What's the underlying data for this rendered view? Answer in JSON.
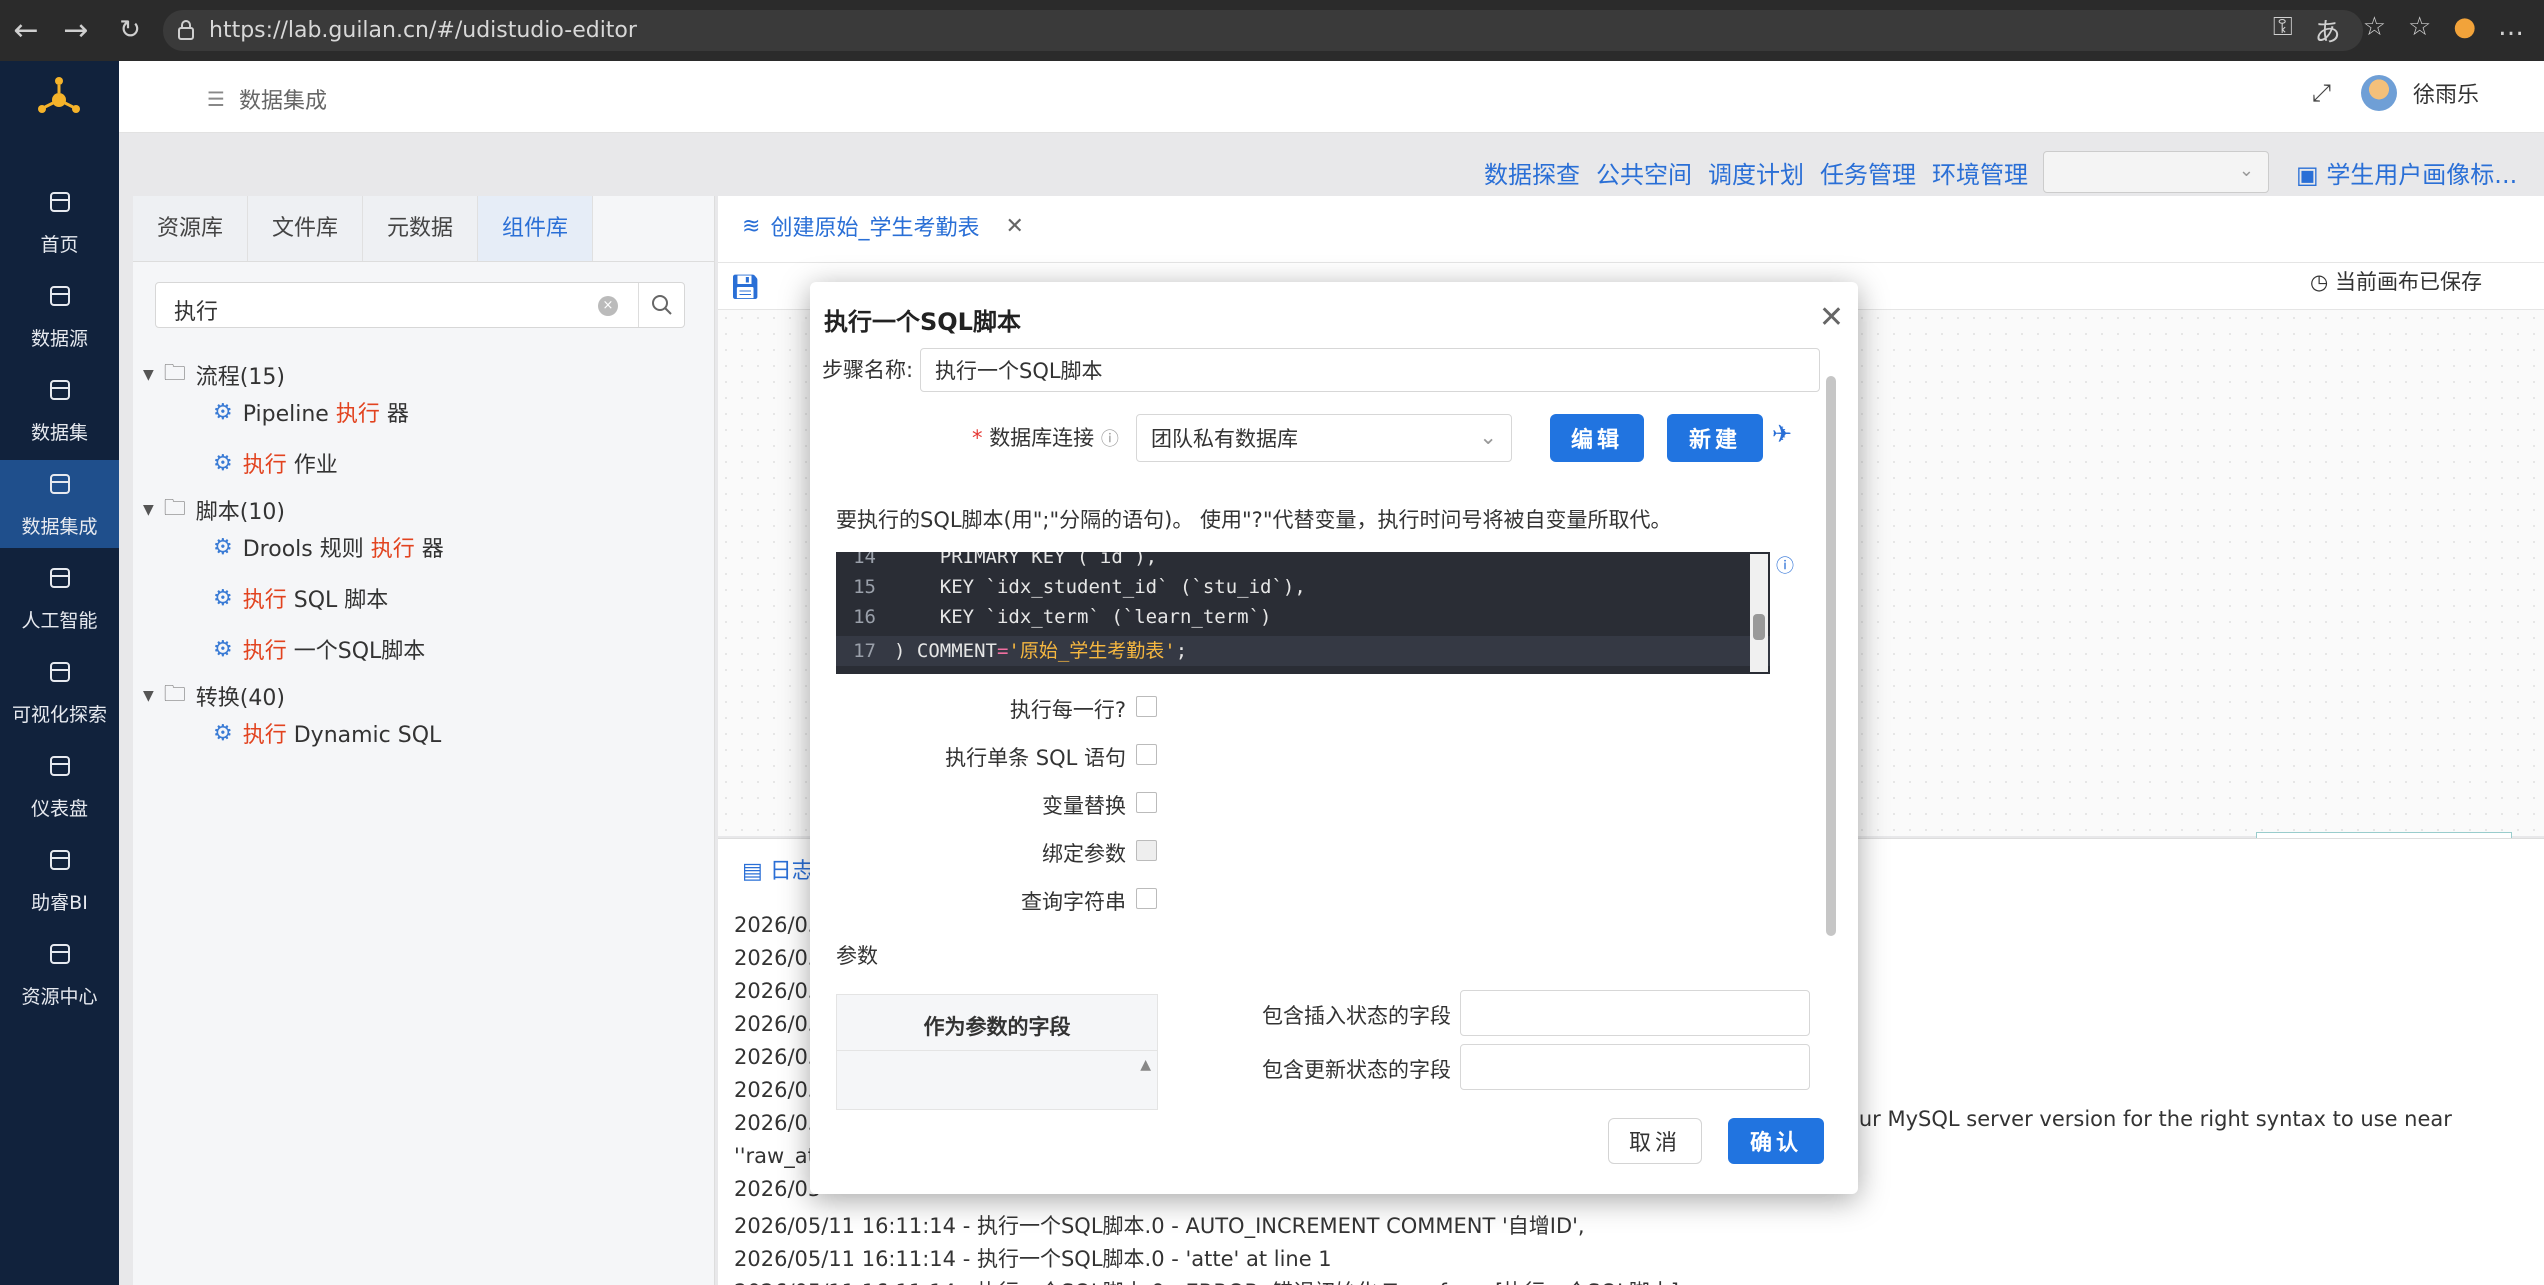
{
  "browser": {
    "url": "https://lab.guilan.cn/#/udistudio-editor"
  },
  "sidebar": {
    "items": [
      {
        "label": "首页",
        "icon": "home-icon"
      },
      {
        "label": "数据源",
        "icon": "database-icon"
      },
      {
        "label": "数据集",
        "icon": "cube-icon"
      },
      {
        "label": "数据集成",
        "icon": "integration-icon",
        "active": true
      },
      {
        "label": "人工智能",
        "icon": "ai-icon"
      },
      {
        "label": "可视化探索",
        "icon": "chart-icon"
      },
      {
        "label": "仪表盘",
        "icon": "gauge-icon"
      },
      {
        "label": "助睿BI",
        "icon": "bi-icon"
      },
      {
        "label": "资源中心",
        "icon": "resource-icon"
      }
    ]
  },
  "header": {
    "breadcrumb": "数据集成",
    "username": "徐雨乐"
  },
  "subnav": {
    "links": [
      "数据探查",
      "公共空间",
      "调度计划",
      "任务管理",
      "环境管理"
    ],
    "project": "学生用户画像标..."
  },
  "left_panel": {
    "tabs": [
      "资源库",
      "文件库",
      "元数据",
      "组件库"
    ],
    "search_value": "执行",
    "tree": [
      {
        "label": "流程(15)",
        "level": 0
      },
      {
        "pre": "Pipeline ",
        "hl": "执行",
        "post": " 器",
        "level": 1
      },
      {
        "pre": "",
        "hl": "执行",
        "post": " 作业",
        "level": 1
      },
      {
        "label": "脚本(10)",
        "level": 0
      },
      {
        "pre": "Drools 规则 ",
        "hl": "执行",
        "post": " 器",
        "level": 1
      },
      {
        "pre": "",
        "hl": "执行",
        "post": " SQL 脚本",
        "level": 1
      },
      {
        "pre": "",
        "hl": "执行",
        "post": " 一个SQL脚本",
        "level": 1
      },
      {
        "label": "转换(40)",
        "level": 0
      },
      {
        "pre": "",
        "hl": "执行",
        "post": " Dynamic SQL",
        "level": 1
      }
    ]
  },
  "editor": {
    "tab_title": "创建原始_学生考勤表",
    "saved_status": "当前画布已保存",
    "log_tab": "日志"
  },
  "log": {
    "lines": [
      "2026/05",
      "2026/05",
      "2026/05",
      "2026/05",
      "2026/05",
      "2026/05",
      "2026/05",
      "''raw_att",
      "2026/05",
      "2026/05/11 16:11:14 - 执行一个SQL脚本.0 - AUTO_INCREMENT COMMENT '自增ID',",
      "2026/05/11 16:11:14 - 执行一个SQL脚本.0 - 'atte' at line 1",
      "2026/05/11 16:11:14 - 执行一个SQL脚本.0 - ERROR: 错误初始化 Transform [执行一个SQL脚本]"
    ],
    "mysql_hint": "our MySQL server version for the right syntax to use near"
  },
  "modal": {
    "title": "执行一个SQL脚本",
    "step_name_label": "步骤名称:",
    "step_name_value": "执行一个SQL脚本",
    "db_conn_label": "数据库连接",
    "db_conn_value": "团队私有数据库",
    "edit_btn": "编辑",
    "new_btn": "新建",
    "sql_desc": "要执行的SQL脚本(用\";\"分隔的语句)。 使用\"?\"代替变量，执行时问号将被自变量所取代。",
    "code": [
      {
        "n": "14",
        "t": "    PRIMARY KEY (`id`),"
      },
      {
        "n": "15",
        "t": "    KEY `idx_student_id` (`stu_id`),"
      },
      {
        "n": "16",
        "t": "    KEY `idx_term` (`learn_term`)"
      },
      {
        "n": "17",
        "t": ") COMMENT='原始_学生考勤表';"
      }
    ],
    "options": [
      "执行每一行?",
      "执行单条 SQL 语句",
      "变量替换",
      "绑定参数",
      "查询字符串"
    ],
    "params_label": "参数",
    "param_col": "作为参数的字段",
    "insert_field_label": "包含插入状态的字段",
    "update_field_label": "包含更新状态的字段",
    "cancel_btn": "取消",
    "confirm_btn": "确认"
  },
  "colors": {
    "sidebar_bg": "#11223c",
    "accent": "#2174e0",
    "highlight": "#e2431f"
  }
}
